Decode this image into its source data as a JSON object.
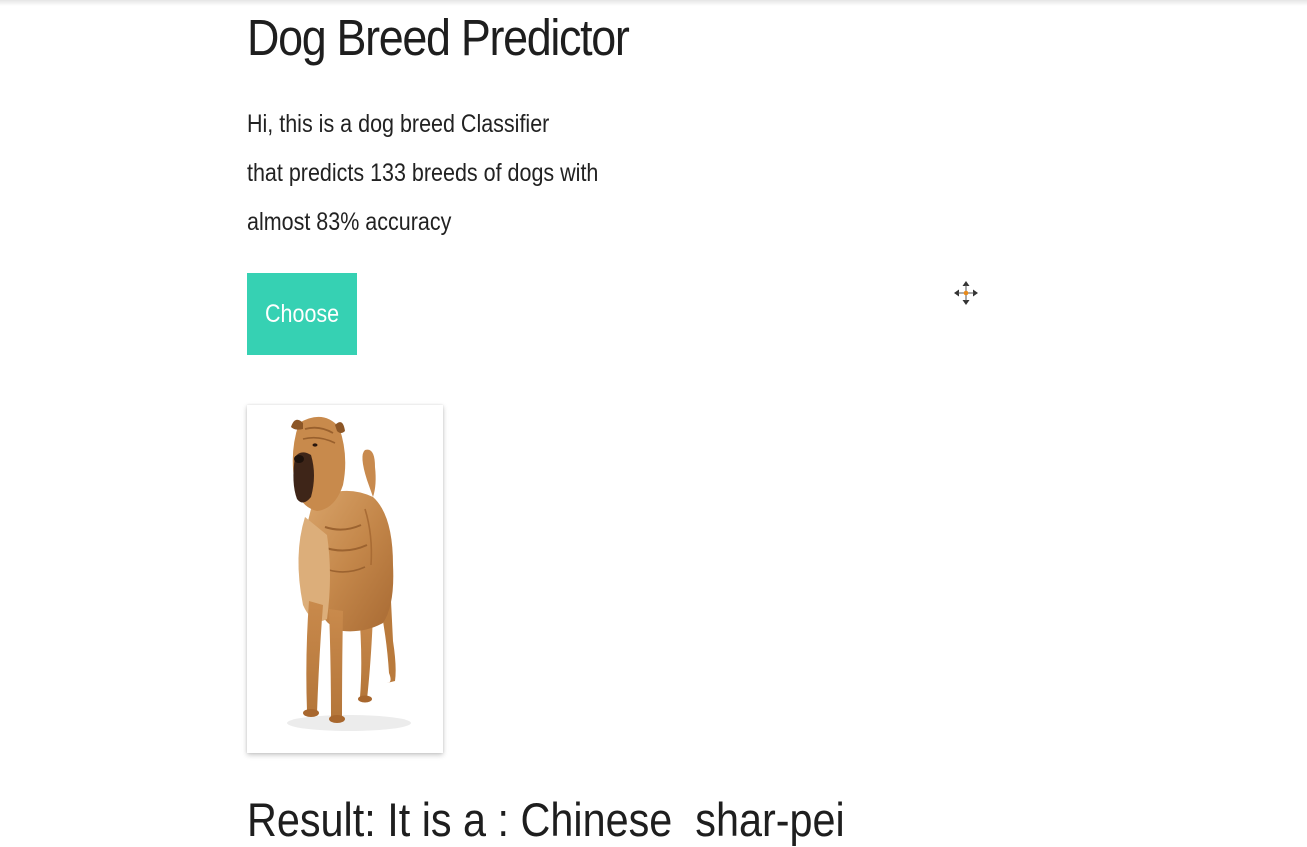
{
  "header": {
    "title": "Dog Breed Predictor"
  },
  "intro": {
    "lines": [
      "Hi, this is a dog breed Classifier",
      "that predicts 133 breeds of dogs with",
      "almost 83% accuracy"
    ]
  },
  "upload": {
    "button_label": "Choose",
    "button_color": "#36d1b3"
  },
  "result": {
    "prefix": "Result: It is a : ",
    "breed": "Chinese  shar-pei"
  }
}
